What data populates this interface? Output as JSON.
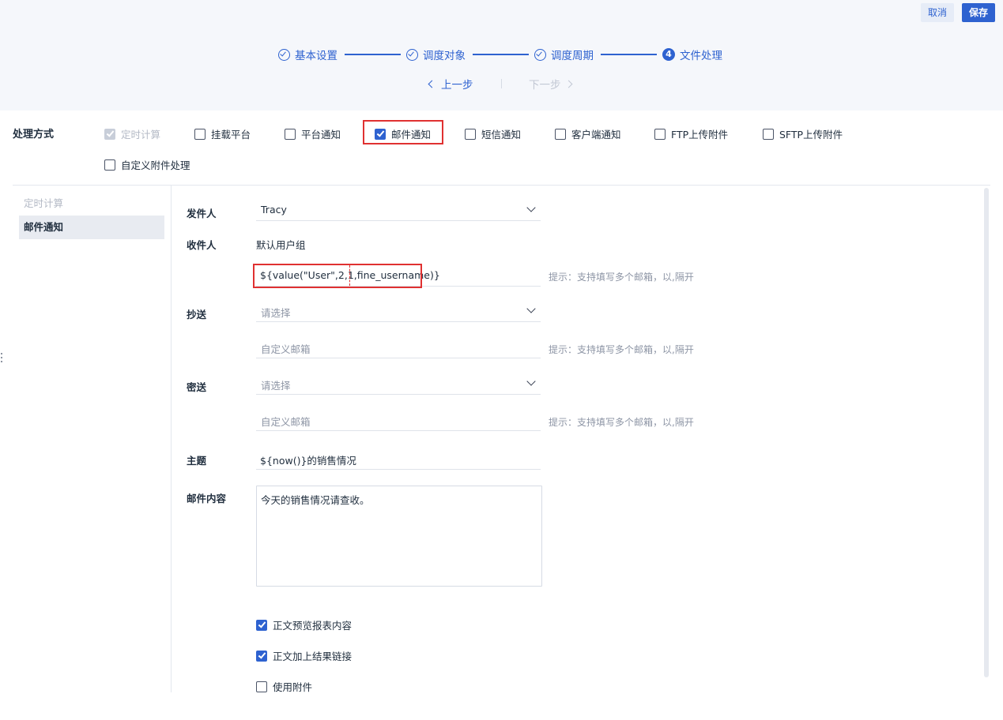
{
  "header": {
    "cancel_label": "取消",
    "save_label": "保存"
  },
  "steps": [
    {
      "label": "基本设置",
      "state": "done"
    },
    {
      "label": "调度对象",
      "state": "done"
    },
    {
      "label": "调度周期",
      "state": "done"
    },
    {
      "label": "文件处理",
      "state": "current",
      "number": "4"
    }
  ],
  "pager": {
    "prev_label": "上一步",
    "next_label": "下一步"
  },
  "method": {
    "label": "处理方式",
    "options": [
      {
        "label": "定时计算",
        "checked": true,
        "disabled": true
      },
      {
        "label": "挂载平台",
        "checked": false
      },
      {
        "label": "平台通知",
        "checked": false
      },
      {
        "label": "邮件通知",
        "checked": true,
        "highlighted": true
      },
      {
        "label": "短信通知",
        "checked": false
      },
      {
        "label": "客户端通知",
        "checked": false
      },
      {
        "label": "FTP上传附件",
        "checked": false
      },
      {
        "label": "SFTP上传附件",
        "checked": false
      },
      {
        "label": "自定义附件处理",
        "checked": false
      }
    ]
  },
  "nav": {
    "items": [
      {
        "label": "定时计算",
        "state": "muted"
      },
      {
        "label": "邮件通知",
        "state": "active"
      }
    ]
  },
  "form": {
    "sender": {
      "label": "发件人",
      "value": "Tracy"
    },
    "recipient": {
      "label": "收件人",
      "group": "默认用户组",
      "value": "${value(\"User\",2,1,fine_username)}",
      "hint": "提示：支持填写多个邮箱，以,隔开"
    },
    "cc": {
      "label": "抄送",
      "select_placeholder": "请选择",
      "custom_placeholder": "自定义邮箱",
      "hint": "提示：支持填写多个邮箱，以,隔开"
    },
    "bcc": {
      "label": "密送",
      "select_placeholder": "请选择",
      "custom_placeholder": "自定义邮箱",
      "hint": "提示：支持填写多个邮箱，以,隔开"
    },
    "subject": {
      "label": "主题",
      "value": "${now()}的销售情况"
    },
    "content": {
      "label": "邮件内容",
      "value": "今天的销售情况请查收。"
    },
    "options": [
      {
        "label": "正文预览报表内容",
        "checked": true
      },
      {
        "label": "正文加上结果链接",
        "checked": true
      },
      {
        "label": "使用附件",
        "checked": false
      }
    ]
  },
  "colors": {
    "accent": "#2e62d0",
    "highlight_border": "#e03131",
    "header_bg": "#f5f7fb"
  }
}
